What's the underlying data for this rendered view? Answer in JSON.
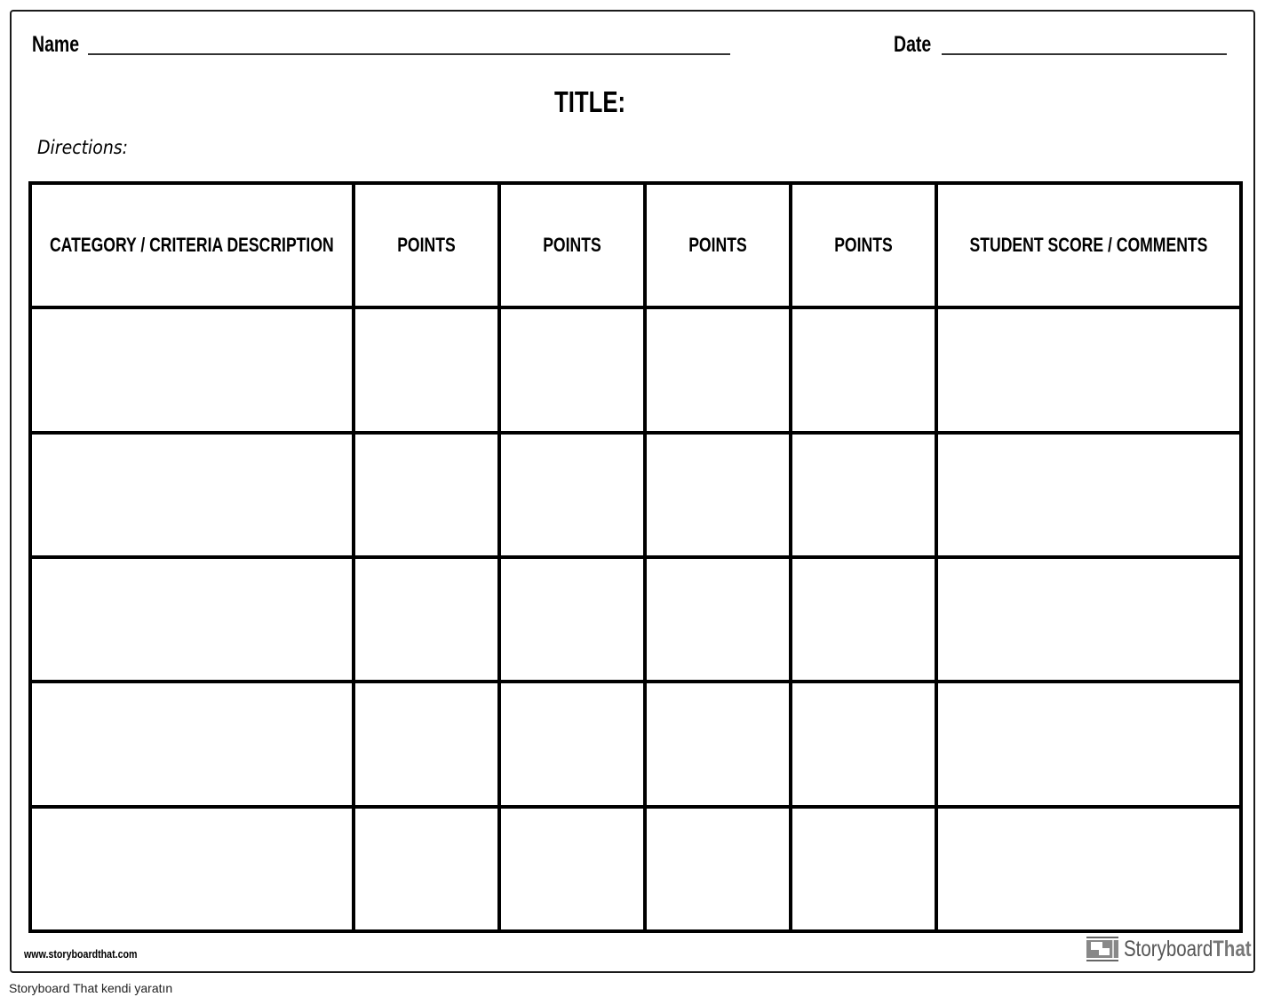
{
  "worksheet": {
    "name_label": "Name",
    "date_label": "Date",
    "title_label": "TITLE:",
    "directions_label": "Directions:"
  },
  "table": {
    "headers": [
      "CATEGORY / CRITERIA DESCRIPTION",
      "POINTS",
      "POINTS",
      "POINTS",
      "POINTS",
      "STUDENT SCORE / COMMENTS"
    ],
    "rows": [
      [
        "",
        "",
        "",
        "",
        "",
        ""
      ],
      [
        "",
        "",
        "",
        "",
        "",
        ""
      ],
      [
        "",
        "",
        "",
        "",
        "",
        ""
      ],
      [
        "",
        "",
        "",
        "",
        "",
        ""
      ],
      [
        "",
        "",
        "",
        "",
        "",
        ""
      ]
    ]
  },
  "footer": {
    "website": "www.storyboardthat.com",
    "brand_primary": "Storyboard",
    "brand_secondary": "That",
    "brand_icon": "storyboard-logo-icon"
  },
  "caption": "Storyboard That kendi yaratın",
  "colors": {
    "border": "#000000",
    "brand_text": "#555555",
    "brand_accent": "#777777"
  }
}
